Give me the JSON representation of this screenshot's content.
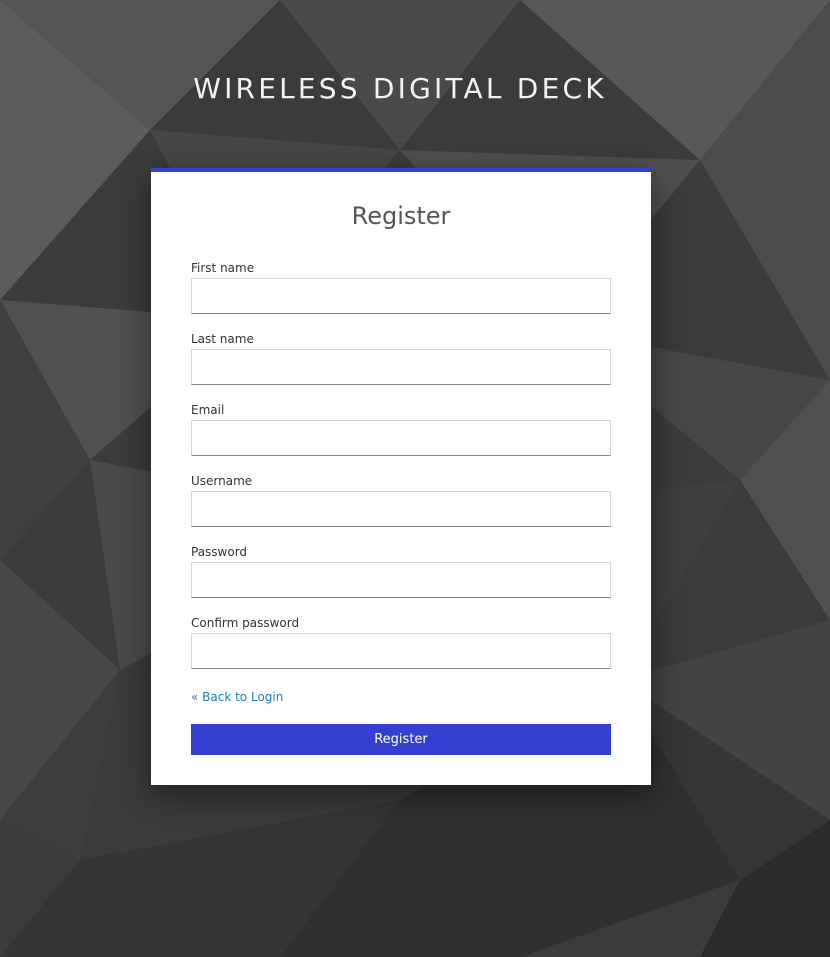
{
  "site": {
    "title": "WIRELESS DIGITAL DECK"
  },
  "form": {
    "title": "Register",
    "fields": [
      {
        "label": "First name",
        "value": "",
        "placeholder": ""
      },
      {
        "label": "Last name",
        "value": "",
        "placeholder": ""
      },
      {
        "label": "Email",
        "value": "",
        "placeholder": ""
      },
      {
        "label": "Username",
        "value": "",
        "placeholder": ""
      },
      {
        "label": "Password",
        "value": "",
        "placeholder": ""
      },
      {
        "label": "Confirm password",
        "value": "",
        "placeholder": ""
      }
    ],
    "back_link": "« Back to Login",
    "submit_label": "Register"
  },
  "colors": {
    "accent": "#3340cf",
    "link": "#1a7fc1",
    "background": "#3a3a3a"
  }
}
